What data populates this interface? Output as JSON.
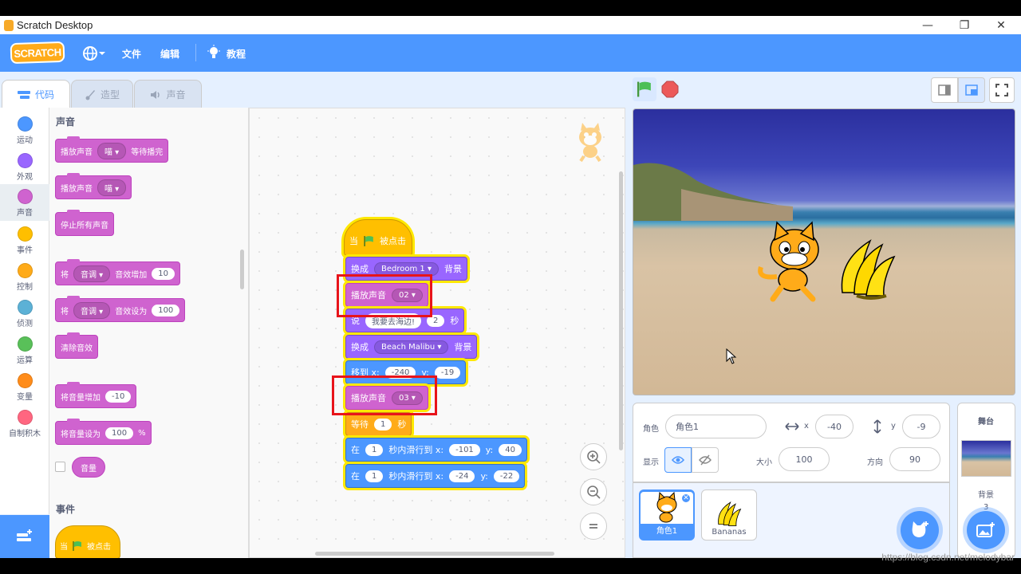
{
  "window": {
    "title": "Scratch Desktop",
    "minimize": "—",
    "restore": "❐",
    "close": "✕"
  },
  "menubar": {
    "logo": "SCRATCH",
    "file": "文件",
    "edit": "编辑",
    "tutorials": "教程"
  },
  "tabs": [
    {
      "label": "代码"
    },
    {
      "label": "造型"
    },
    {
      "label": "声音"
    }
  ],
  "categories": [
    {
      "label": "运动",
      "color": "#4c97ff"
    },
    {
      "label": "外观",
      "color": "#9966ff"
    },
    {
      "label": "声音",
      "color": "#cf63cf"
    },
    {
      "label": "事件",
      "color": "#ffbf00"
    },
    {
      "label": "控制",
      "color": "#ffab19"
    },
    {
      "label": "侦测",
      "color": "#5cb1d6"
    },
    {
      "label": "运算",
      "color": "#59c059"
    },
    {
      "label": "变量",
      "color": "#ff8c1a"
    },
    {
      "label": "自制积木",
      "color": "#ff6680"
    }
  ],
  "palette": {
    "section_sound": "声音",
    "play_until_done": {
      "text": "播放声音",
      "sound": "喵",
      "suffix": "等待播完"
    },
    "start_sound": {
      "text": "播放声音",
      "sound": "喵"
    },
    "stop_all": "停止所有声音",
    "change_effect": {
      "prefix": "将",
      "effect": "音调",
      "text": "音效增加",
      "value": "10"
    },
    "set_effect": {
      "prefix": "将",
      "effect": "音调",
      "text": "音效设为",
      "value": "100"
    },
    "clear_effects": "清除音效",
    "change_volume": {
      "text": "将音量增加",
      "value": "-10"
    },
    "set_volume": {
      "text": "将音量设为",
      "value": "100",
      "unit": "%"
    },
    "volume_reporter": "音量",
    "section_events": "事件",
    "flag_hat": {
      "prefix": "当",
      "suffix": "被点击"
    }
  },
  "script": {
    "hat": {
      "prefix": "当",
      "suffix": "被点击"
    },
    "switch1": {
      "text": "换成",
      "value": "Bedroom 1",
      "suffix": "背景"
    },
    "play1": {
      "text": "播放声音",
      "value": "02"
    },
    "say": {
      "text": "说",
      "message": "我要去海边!",
      "secs": "2",
      "unit": "秒"
    },
    "switch2": {
      "text": "换成",
      "value": "Beach Malibu",
      "suffix": "背景"
    },
    "goto": {
      "text": "移到 x:",
      "x": "-240",
      "ylabel": "y:",
      "y": "-19"
    },
    "play2": {
      "text": "播放声音",
      "value": "03"
    },
    "wait": {
      "text": "等待",
      "value": "1",
      "unit": "秒"
    },
    "glide1": {
      "prefix": "在",
      "secs": "1",
      "text": "秒内滑行到 x:",
      "x": "-101",
      "ylabel": "y:",
      "y": "40"
    },
    "glide2": {
      "prefix": "在",
      "secs": "1",
      "text": "秒内滑行到 x:",
      "x": "-24",
      "ylabel": "y:",
      "y": "-22"
    }
  },
  "sprite_info": {
    "label_sprite": "角色",
    "name": "角色1",
    "label_x": "x",
    "x": "-40",
    "label_y": "y",
    "y": "-9",
    "label_show": "显示",
    "label_size": "大小",
    "size": "100",
    "label_direction": "方向",
    "direction": "90"
  },
  "sprites": [
    {
      "name": "角色1"
    },
    {
      "name": "Bananas"
    }
  ],
  "stage_panel": {
    "title": "舞台",
    "label_backdrops": "背景",
    "backdrop_count": "3"
  },
  "watermark": "https://blog.csdn.net/melodybar"
}
